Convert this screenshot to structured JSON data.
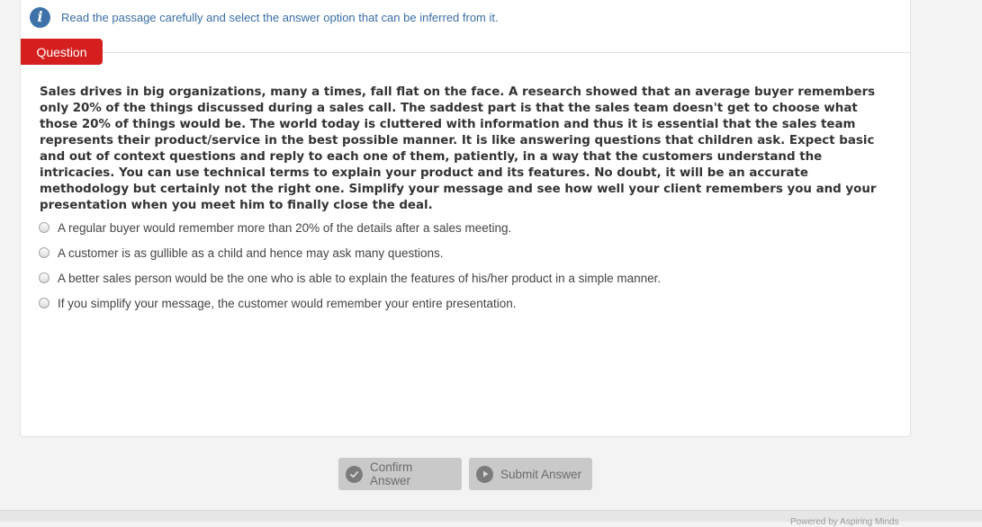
{
  "instruction": {
    "icon": "info-icon",
    "text": "Read the passage carefully and select the answer option that can be inferred from it."
  },
  "question_tab": {
    "label": "Question",
    "color": "#d51f1f"
  },
  "passage": "Sales drives in big organizations, many a times, fall flat on the face. A research showed that an average buyer remembers only 20% of the things discussed during a sales call. The saddest part is that the sales team doesn't get to choose what those 20% of things would be. The world today is cluttered with information and thus it is essential that the sales team represents their product/service in the best possible manner. It is like answering questions that children ask. Expect basic and out of context questions and reply to each one of them, patiently, in a way that the customers understand the intricacies. You can use technical terms to explain your product and its features. No doubt, it will be an accurate methodology but certainly not the right one. Simplify your message and see how well your client remembers you and your presentation when you meet him to finally close the deal.",
  "options": [
    {
      "label": "A regular buyer would remember more than 20% of the details after a sales meeting.",
      "selected": false
    },
    {
      "label": "A customer is as gullible as a child and hence may ask many questions.",
      "selected": false
    },
    {
      "label": "A better sales person would be the one who is able to explain the features of his/her product in a simple manner.",
      "selected": false
    },
    {
      "label": "If you simplify your message, the customer would remember your entire presentation.",
      "selected": false
    }
  ],
  "buttons": {
    "confirm": {
      "label": "Confirm Answer",
      "icon": "check-circle-icon"
    },
    "submit": {
      "label": "Submit Answer",
      "icon": "play-circle-icon"
    }
  },
  "footer": {
    "text": "Powered by Aspiring Minds"
  }
}
